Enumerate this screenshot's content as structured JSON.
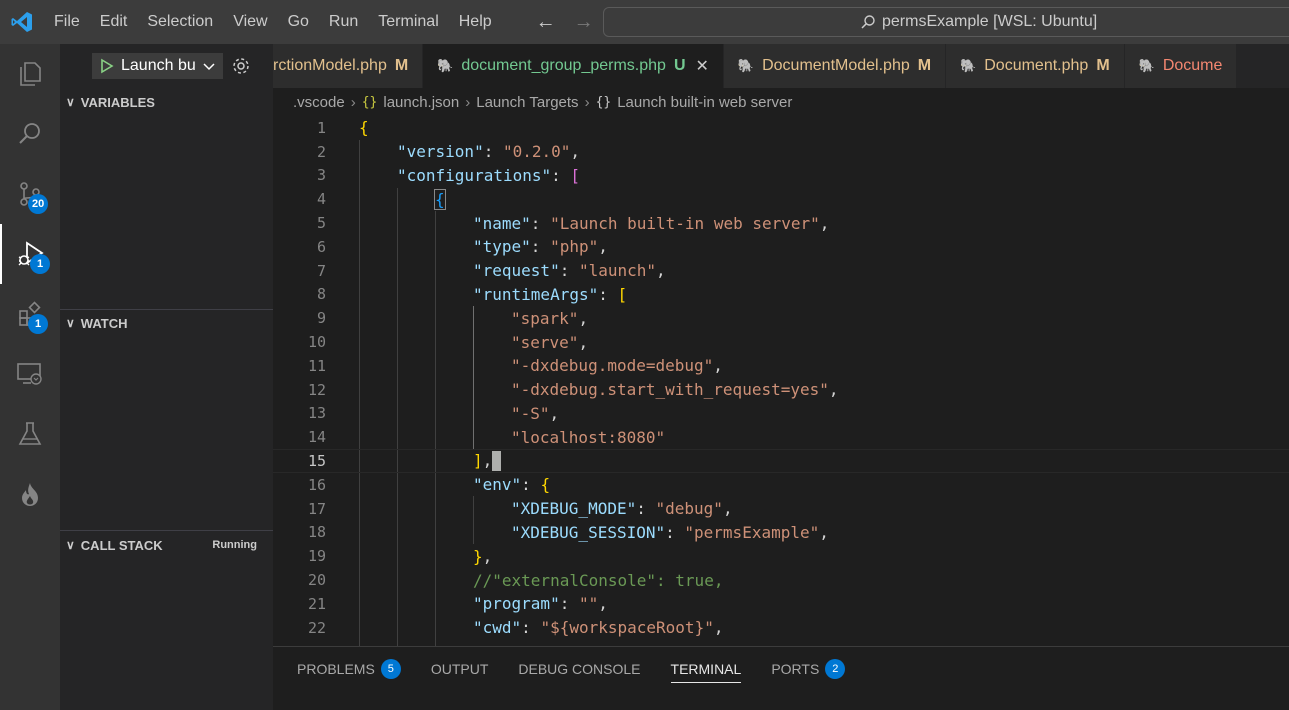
{
  "menu": [
    "File",
    "Edit",
    "Selection",
    "View",
    "Go",
    "Run",
    "Terminal",
    "Help"
  ],
  "command_center": {
    "label": "permsExample [WSL: Ubuntu]"
  },
  "activity": {
    "source_control_badge": "20",
    "run_debug_badge": "1",
    "extensions_badge": "1"
  },
  "run": {
    "config_label": "Launch bu"
  },
  "sidebar": {
    "variables": "VARIABLES",
    "watch": "WATCH",
    "call_stack": "CALL STACK",
    "call_stack_status": "Running"
  },
  "tabs": [
    {
      "label": "rctionModel.php",
      "status": "M"
    },
    {
      "label": "document_group_perms.php",
      "status": "U"
    },
    {
      "label": "DocumentModel.php",
      "status": "M"
    },
    {
      "label": "Document.php",
      "status": "M"
    },
    {
      "label": "Docume",
      "status": ""
    }
  ],
  "breadcrumb": [
    ".vscode",
    "launch.json",
    "Launch Targets",
    "Launch built-in web server"
  ],
  "editor": {
    "current_line": 15,
    "lines": [
      {
        "n": "1"
      },
      {
        "n": "2"
      },
      {
        "n": "3"
      },
      {
        "n": "4"
      },
      {
        "n": "5"
      },
      {
        "n": "6"
      },
      {
        "n": "7"
      },
      {
        "n": "8"
      },
      {
        "n": "9"
      },
      {
        "n": "10"
      },
      {
        "n": "11"
      },
      {
        "n": "12"
      },
      {
        "n": "13"
      },
      {
        "n": "14"
      },
      {
        "n": "15"
      },
      {
        "n": "16"
      },
      {
        "n": "17"
      },
      {
        "n": "18"
      },
      {
        "n": "19"
      },
      {
        "n": "20"
      },
      {
        "n": "21"
      },
      {
        "n": "22"
      }
    ],
    "tokens": {
      "l2k": "\"version\"",
      "l2v": "\"0.2.0\"",
      "l3k": "\"configurations\"",
      "l5k": "\"name\"",
      "l5v": "\"Launch built-in web server\"",
      "l6k": "\"type\"",
      "l6v": "\"php\"",
      "l7k": "\"request\"",
      "l7v": "\"launch\"",
      "l8k": "\"runtimeArgs\"",
      "l9v": "\"spark\"",
      "l10v": "\"serve\"",
      "l11v": "\"-dxdebug.mode=debug\"",
      "l12v": "\"-dxdebug.start_with_request=yes\"",
      "l13v": "\"-S\"",
      "l14v": "\"localhost:8080\"",
      "l16k": "\"env\"",
      "l17k": "\"XDEBUG_MODE\"",
      "l17v": "\"debug\"",
      "l18k": "\"XDEBUG_SESSION\"",
      "l18v": "\"permsExample\"",
      "l20c": "//\"externalConsole\": true,",
      "l21k": "\"program\"",
      "l21v": "\"\"",
      "l22k": "\"cwd\"",
      "l22v": "\"${workspaceRoot}\""
    }
  },
  "panel": {
    "tabs": [
      {
        "label": "PROBLEMS",
        "badge": "5"
      },
      {
        "label": "OUTPUT",
        "badge": ""
      },
      {
        "label": "DEBUG CONSOLE",
        "badge": ""
      },
      {
        "label": "TERMINAL",
        "badge": ""
      },
      {
        "label": "PORTS",
        "badge": "2"
      }
    ]
  },
  "colors": {
    "accent": "#0078d4",
    "modified": "#e2c08d",
    "untracked": "#73c991",
    "error": "#f48771"
  }
}
